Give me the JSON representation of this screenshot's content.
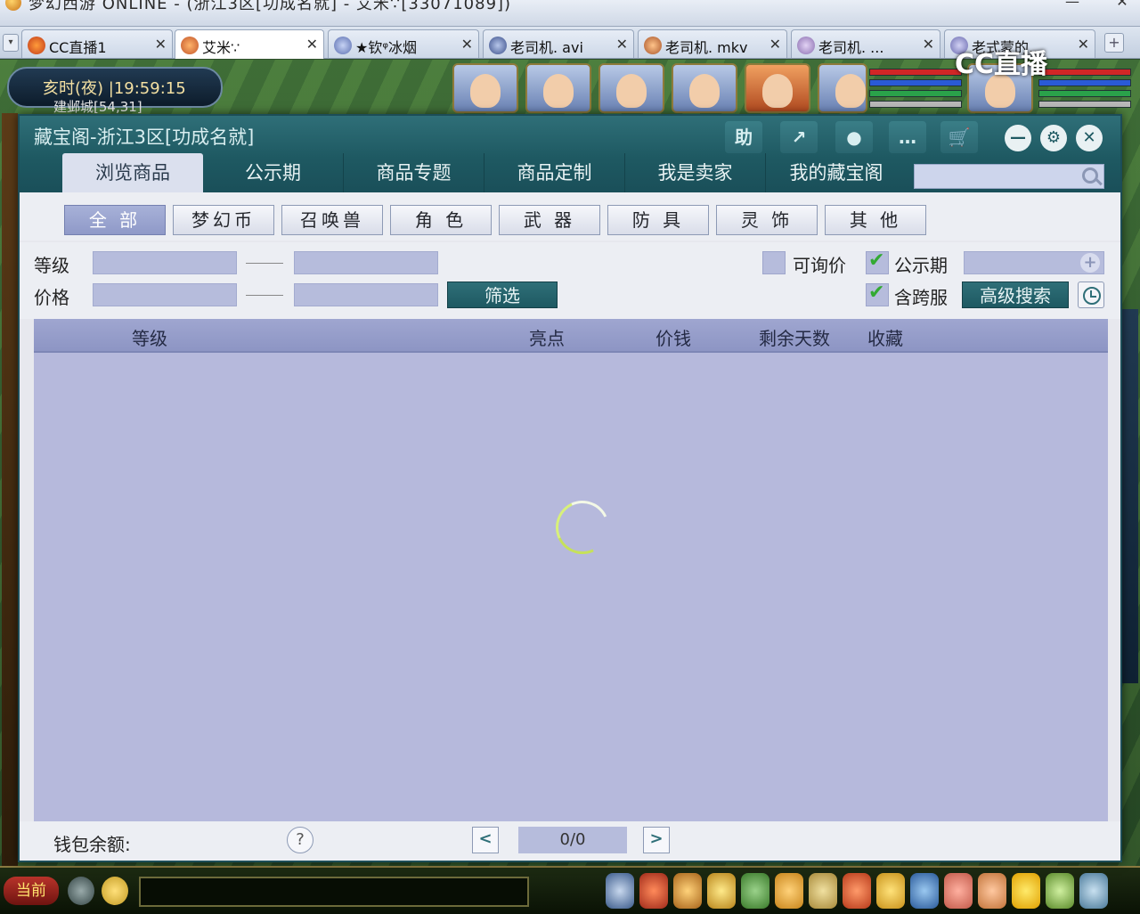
{
  "window": {
    "title": "梦幻西游 ONLINE - (浙江3区[功成名就] - 艾米∵[33071089])",
    "minimize_symbol": "—",
    "close_symbol": "✕"
  },
  "browser_tabs": {
    "menu_symbol": "▾",
    "items": [
      {
        "label": "CC直播1",
        "active": false
      },
      {
        "label": "艾米∵",
        "active": true
      },
      {
        "label": "★钦ᵠ冰烟",
        "active": false
      },
      {
        "label": "老司机. avi",
        "active": false
      },
      {
        "label": "老司机. mkv",
        "active": false
      },
      {
        "label": "老司机. ...",
        "active": false
      },
      {
        "label": "老式蒙的...",
        "active": false
      }
    ],
    "close_symbol": "✕",
    "add_symbol": "+"
  },
  "game": {
    "clock": "亥时(夜) |19:59:15",
    "location": "建邺城[54,31]",
    "watermark": "CC直播",
    "current_channel": "当前"
  },
  "cbg": {
    "title": "藏宝阁-浙江3区[功成名就]",
    "toolbar": {
      "help_label": "助",
      "share_icon": "↗",
      "record_icon": "●",
      "chat_icon": "…",
      "cart_icon": "🛒",
      "minimize_icon": "—",
      "settings_icon": "⚙",
      "close_icon": "✕"
    },
    "nav_tabs": [
      "浏览商品",
      "公示期",
      "商品专题",
      "商品定制",
      "我是卖家",
      "我的藏宝阁"
    ],
    "search": {
      "value": "",
      "placeholder": ""
    },
    "categories": [
      "全 部",
      "梦幻币",
      "召唤兽",
      "角 色",
      "武 器",
      "防 具",
      "灵 饰",
      "其 他"
    ],
    "filters": {
      "level_label": "等级",
      "price_label": "价格",
      "filter_button": "筛选",
      "inquiry_label": "可询价",
      "inquiry_checked": false,
      "publicity_label": "公示期",
      "publicity_checked": true,
      "cross_server_label": "含跨服",
      "cross_server_checked": true,
      "advanced_search_button": "高级搜索",
      "plus_symbol": "+"
    },
    "table": {
      "columns": [
        "等级",
        "亮点",
        "价钱",
        "剩余天数",
        "收藏"
      ],
      "rows": []
    },
    "footer": {
      "wallet_label": "钱包余额:",
      "help_symbol": "?",
      "prev_symbol": "<",
      "next_symbol": ">",
      "page_indicator": "0/0"
    }
  },
  "colors": {
    "header_teal": "#1e5962",
    "table_bg": "#b6b9dc",
    "active_category": "#8f99c8"
  }
}
